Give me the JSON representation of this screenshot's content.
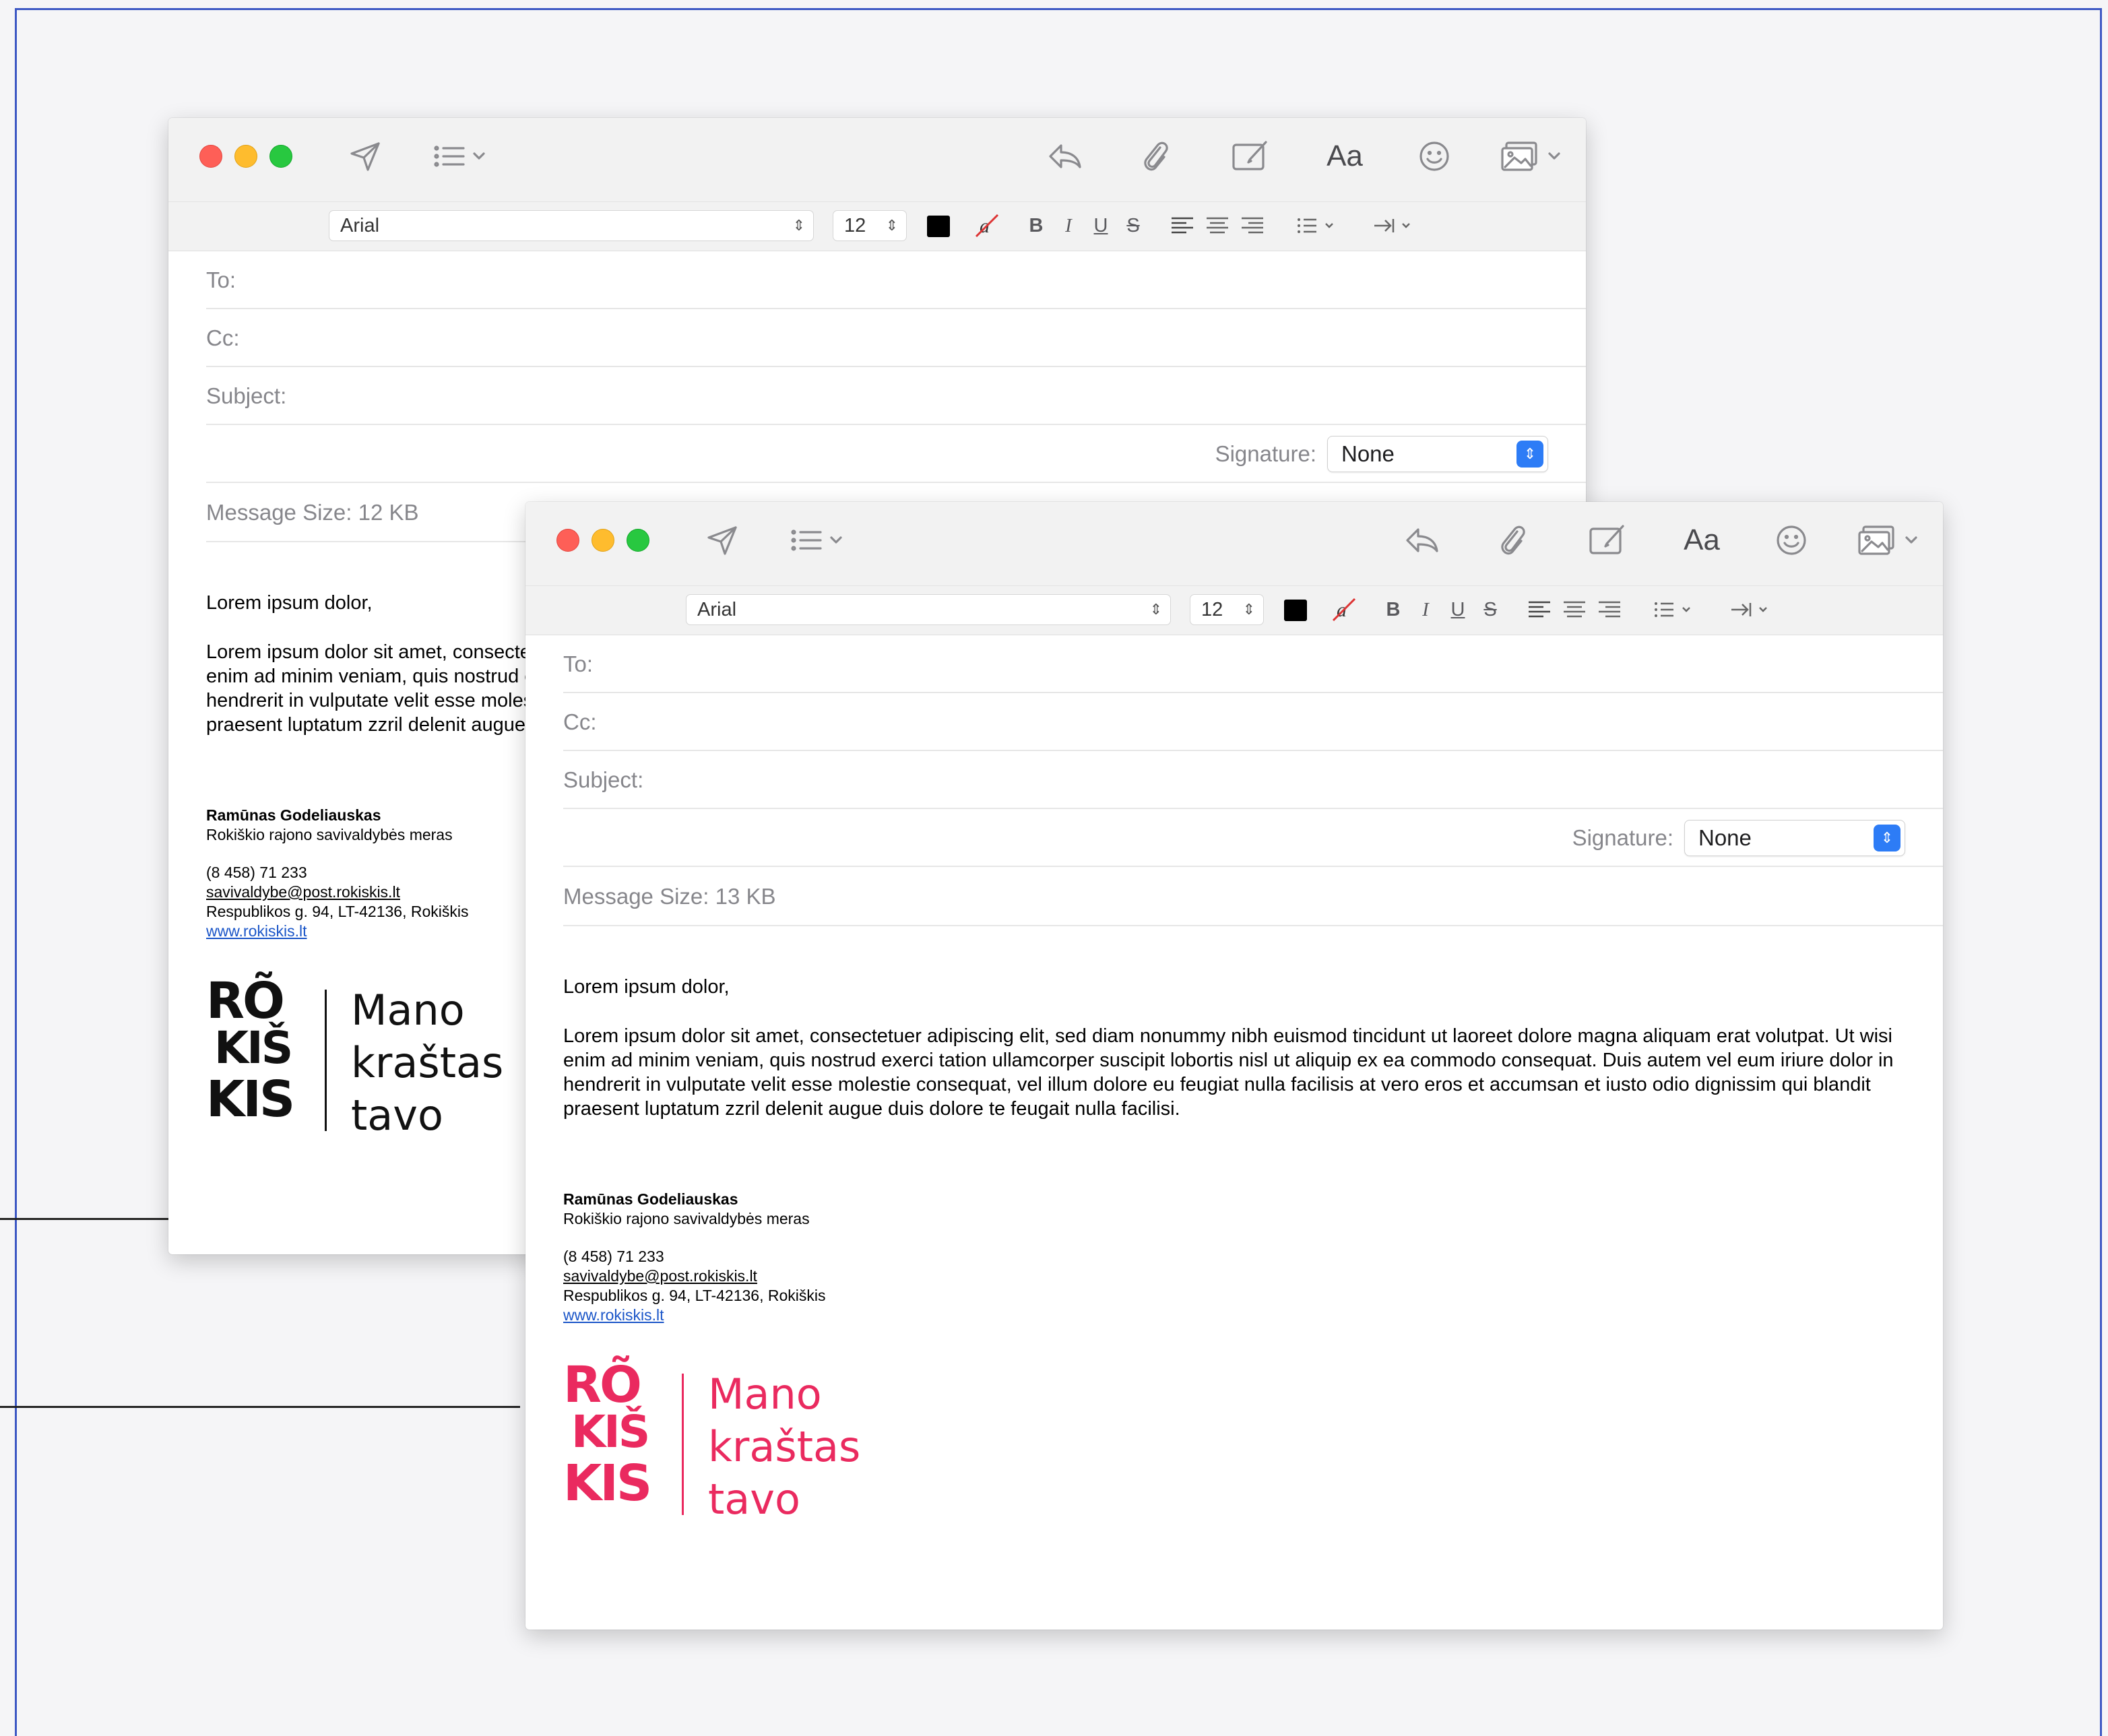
{
  "toolbar": {
    "send_icon": "paper-plane-icon",
    "list_icon": "header-fields-list-icon",
    "reply_icon": "reply-icon",
    "attach_icon": "paperclip-icon",
    "markup_icon": "markup-icon",
    "fonts_label": "Aa",
    "emoji_icon": "smiley-icon",
    "photo_icon": "photo-browser-icon"
  },
  "format": {
    "font": "Arial",
    "size": "12",
    "text_color": "#000000",
    "bold": "B",
    "italic": "I",
    "underline": "U",
    "strike": "S"
  },
  "fields": {
    "to_label": "To:",
    "cc_label": "Cc:",
    "subject_label": "Subject:",
    "signature_label": "Signature:",
    "signature_value": "None"
  },
  "back_window": {
    "message_size": "Message Size: 12 KB"
  },
  "front_window": {
    "message_size": "Message Size: 13 KB"
  },
  "message": {
    "greeting": "Lorem ipsum dolor,",
    "body": "Lorem ipsum dolor sit amet, consectetuer adipiscing elit, sed diam nonummy nibh euismod tincidunt ut laoreet dolore magna aliquam erat volutpat. Ut wisi enim ad minim veniam, quis nostrud exerci tation ullamcorper suscipit lobortis nisl ut aliquip ex ea commodo consequat. Duis autem vel eum iriure dolor in hendrerit in vulputate velit esse molestie consequat, vel illum dolore eu feugiat nulla facilisis at vero eros et accumsan et iusto odio dignissim qui blandit praesent luptatum zzril delenit augue duis dolore te feugait nulla facilisi."
  },
  "signature": {
    "name": "Ramūnas Godeliauskas",
    "title": "Rokiškio rajono savivaldybės meras",
    "phone": "(8 458) 71 233",
    "email": "savivaldybe@post.rokiskis.lt",
    "address": "Respublikos g. 94, LT-42136, Rokiškis",
    "website": "www.rokiskis.lt"
  },
  "logo": {
    "line1": "RÕ",
    "line2": "KIŠ",
    "line3": "KIS",
    "tag1": "Mano",
    "tag2": "kraštas",
    "tag3": "tavo",
    "back_color": "#111111",
    "front_color": "#ea2a5f"
  },
  "colors": {
    "accent": "#2d7cf6",
    "border": "#3d58c4"
  }
}
